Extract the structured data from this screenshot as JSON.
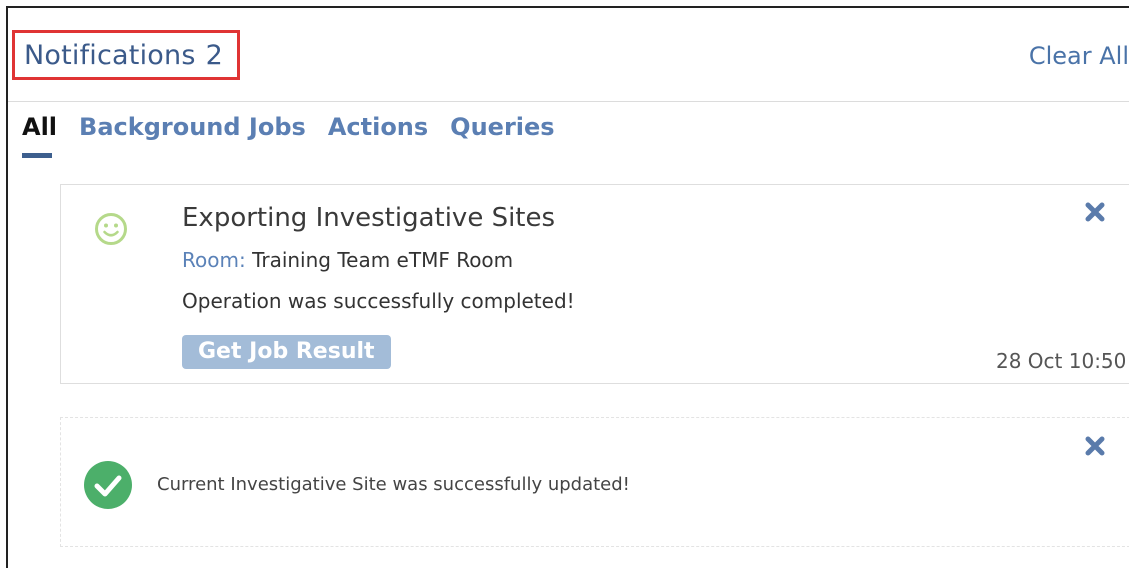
{
  "header": {
    "title": "Notifications",
    "count": "2",
    "clear_all": "Clear All"
  },
  "tabs": [
    {
      "label": "All",
      "active": true
    },
    {
      "label": "Background Jobs",
      "active": false
    },
    {
      "label": "Actions",
      "active": false
    },
    {
      "label": "Queries",
      "active": false
    }
  ],
  "notifications": [
    {
      "icon": "smile-icon",
      "title": "Exporting Investigative Sites",
      "room_label": "Room:",
      "room_value": "Training Team eTMF Room",
      "message": "Operation was successfully completed!",
      "button_label": "Get Job Result",
      "timestamp": "28 Oct 10:50"
    },
    {
      "icon": "check-circle-icon",
      "message": "Current Investigative Site was successfully updated!"
    }
  ],
  "colors": {
    "accent": "#3b5a8a",
    "link": "#5b7fb3",
    "highlight": "#e03434",
    "success": "#4caf6a",
    "smile": "#b5d98a",
    "button_bg": "#a3bcd8"
  }
}
